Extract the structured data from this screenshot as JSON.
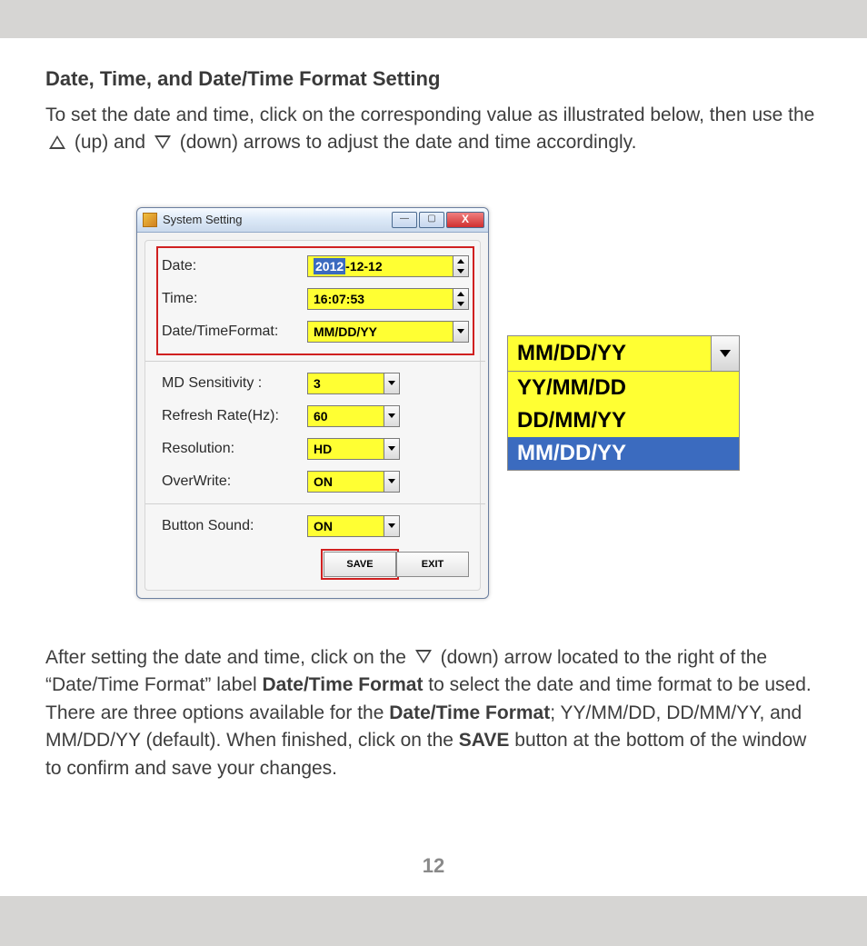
{
  "doc": {
    "title": "Date, Time, and Date/Time Format Setting",
    "intro_a": "To set the date and time, click on the corresponding value as illustrated below, then use the ",
    "intro_up": "(up) and ",
    "intro_down": "(down) arrows to adjust the date and time accordingly.",
    "after_a": "After setting the date and time, click on the ",
    "after_b": "(down) arrow located to the right of the “Date/Time Format” label ",
    "after_bold1": "Date/Time Format",
    "after_c": " to select the date and time format to be used. There are three options available for the ",
    "after_bold2": "Date/Time Format",
    "after_d": "; YY/MM/DD, DD/MM/YY, and MM/DD/YY (default). When finished, click on the ",
    "after_bold3": "SAVE",
    "after_e": " button at the bottom of the window to confirm and save your changes.",
    "page_number": "12"
  },
  "window": {
    "title": "System Setting",
    "fields": {
      "date_label": "Date:",
      "date_sel": "2012",
      "date_rest": "-12-12",
      "time_label": "Time:",
      "time_value": "16:07:53",
      "fmt_label": "Date/TimeFormat:",
      "fmt_value": "MM/DD/YY",
      "md_label": "MD Sensitivity :",
      "md_value": "3",
      "refresh_label": "Refresh Rate(Hz):",
      "refresh_value": "60",
      "res_label": "Resolution:",
      "res_value": "HD",
      "ow_label": "OverWrite:",
      "ow_value": "ON",
      "bs_label": "Button Sound:",
      "bs_value": "ON"
    },
    "buttons": {
      "save": "SAVE",
      "exit": "EXIT",
      "close": "X"
    }
  },
  "dropdown": {
    "selected": "MM/DD/YY",
    "opt1": "YY/MM/DD",
    "opt2": "DD/MM/YY",
    "opt3": "MM/DD/YY"
  }
}
